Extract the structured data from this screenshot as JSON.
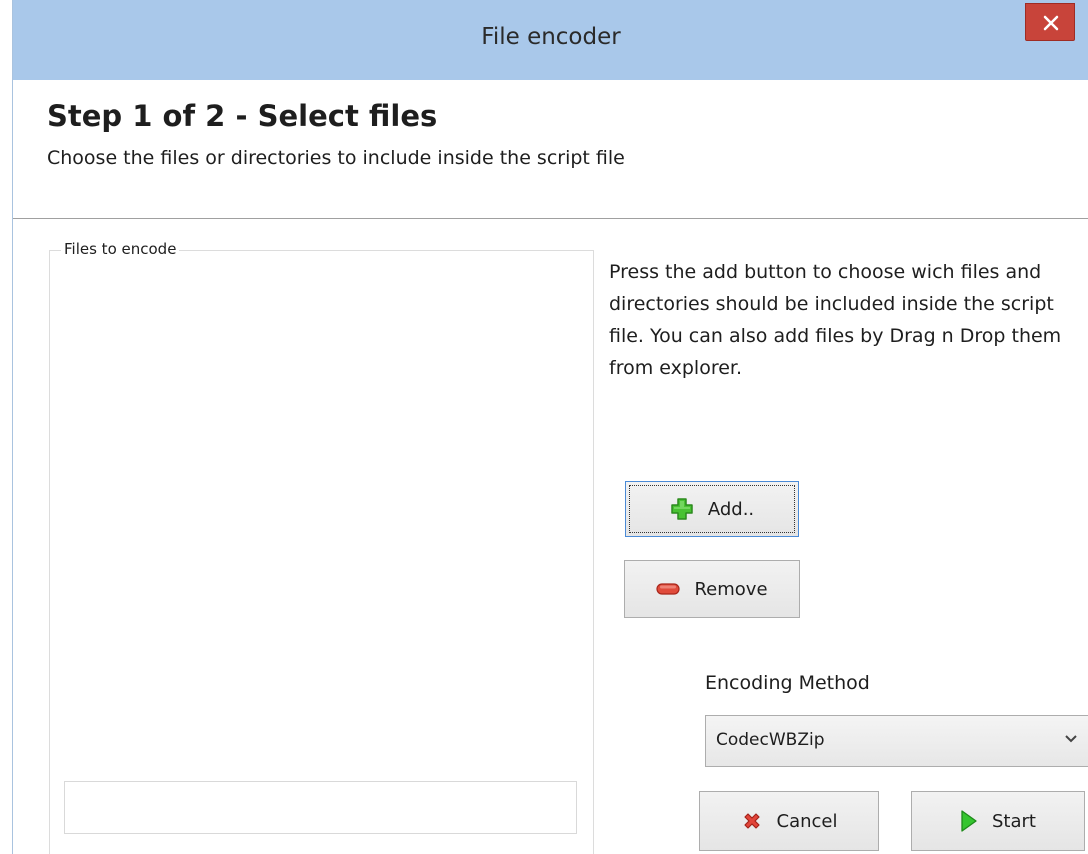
{
  "window": {
    "title": "File encoder",
    "close_glyph": "×"
  },
  "header": {
    "step_title": "Step 1 of 2 - Select files",
    "step_subtitle": "Choose the files or directories to include inside the script file"
  },
  "files_group": {
    "label": "Files to encode",
    "bottom_input_value": ""
  },
  "help_text": "Press the add button to choose wich files and directories should be included inside the script file. You can also add files by Drag n Drop them from explorer.",
  "buttons": {
    "add_label": "Add..",
    "remove_label": "Remove",
    "cancel_label": "Cancel",
    "start_label": "Start"
  },
  "encoding": {
    "label": "Encoding Method",
    "selected": "CodecWBZip"
  },
  "icons": {
    "add": "plus-icon",
    "remove": "minus-icon",
    "cancel": "cancel-x-icon",
    "start": "play-arrow-icon",
    "combo": "chevron-down-icon"
  },
  "colors": {
    "titlebar": "#a9c8ea",
    "close": "#c8443a",
    "add_green": "#3fbf2a",
    "remove_red": "#e04b3b",
    "start_green": "#2fbf2f"
  }
}
